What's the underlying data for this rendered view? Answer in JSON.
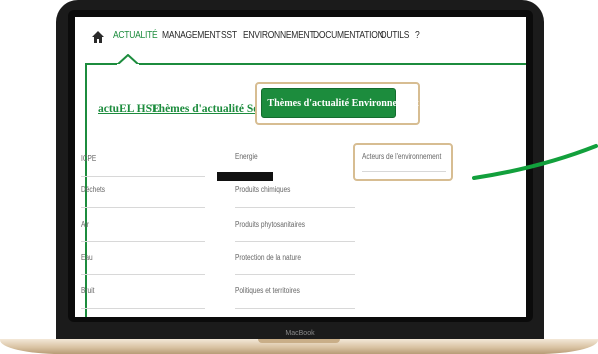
{
  "laptop": {
    "chin_label": "MacBook"
  },
  "nav": {
    "items": [
      {
        "label": "ACTUALITÉ",
        "active": true
      },
      {
        "label": "MANAGEMENT",
        "active": false
      },
      {
        "label": "SST",
        "active": false
      },
      {
        "label": "ENVIRONNEMENT",
        "active": false
      },
      {
        "label": "DOCUMENTATION",
        "active": false
      },
      {
        "label": "OUTILS",
        "active": false
      },
      {
        "label": "?",
        "active": false
      }
    ],
    "home_icon": "home-icon"
  },
  "tabs": {
    "actuel": "actuEL HSE",
    "securite": "Thèmes d'actualité Sécurit",
    "environnement": "Thèmes d'actualité Environnement"
  },
  "themes": {
    "col1": [
      "ICPE",
      "Déchets",
      "Air",
      "Eau",
      "Bruit"
    ],
    "col2": [
      "Energie",
      "Produits chimiques",
      "Produits phytosanitaires",
      "Protection de la nature",
      "Politiques et territoires"
    ],
    "col3": [
      "Acteurs de l'environnement"
    ]
  },
  "colors": {
    "accent": "#1c8c3d",
    "highlight_border": "#d7bd92",
    "pointer_line": "#12a03c"
  }
}
